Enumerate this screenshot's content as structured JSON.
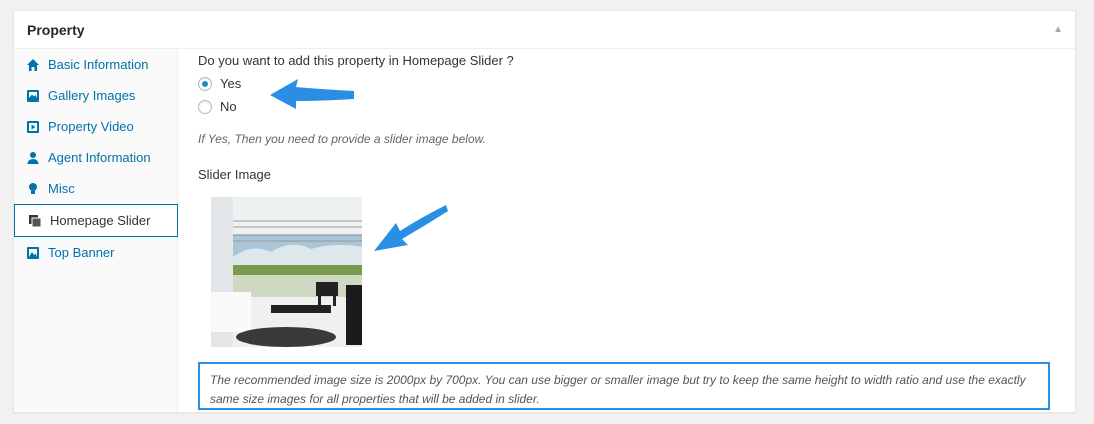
{
  "panel": {
    "title": "Property",
    "collapse_icon": "triangle-up-icon"
  },
  "tabs": [
    {
      "label": "Basic Information",
      "icon": "home-icon"
    },
    {
      "label": "Gallery Images",
      "icon": "gallery-icon"
    },
    {
      "label": "Property Video",
      "icon": "video-icon"
    },
    {
      "label": "Agent Information",
      "icon": "agent-icon"
    },
    {
      "label": "Misc",
      "icon": "lightbulb-icon"
    },
    {
      "label": "Homepage Slider",
      "icon": "slider-icon",
      "active": true
    },
    {
      "label": "Top Banner",
      "icon": "banner-icon"
    }
  ],
  "slider": {
    "question": "Do you want to add this property in Homepage Slider ?",
    "options": [
      {
        "label": "Yes",
        "checked": true
      },
      {
        "label": "No",
        "checked": false
      }
    ],
    "hint": "If Yes, Then you need to provide a slider image below.",
    "image_label": "Slider Image",
    "note": "The recommended image size is 2000px by 700px. You can use bigger or smaller image but try to keep the same height to width ratio and use the exactly same size images for all properties that will be added in slider."
  },
  "colors": {
    "link": "#0073aa",
    "accent_arrow": "#2b8ee5",
    "radio_checked": "#1e8cbe"
  }
}
